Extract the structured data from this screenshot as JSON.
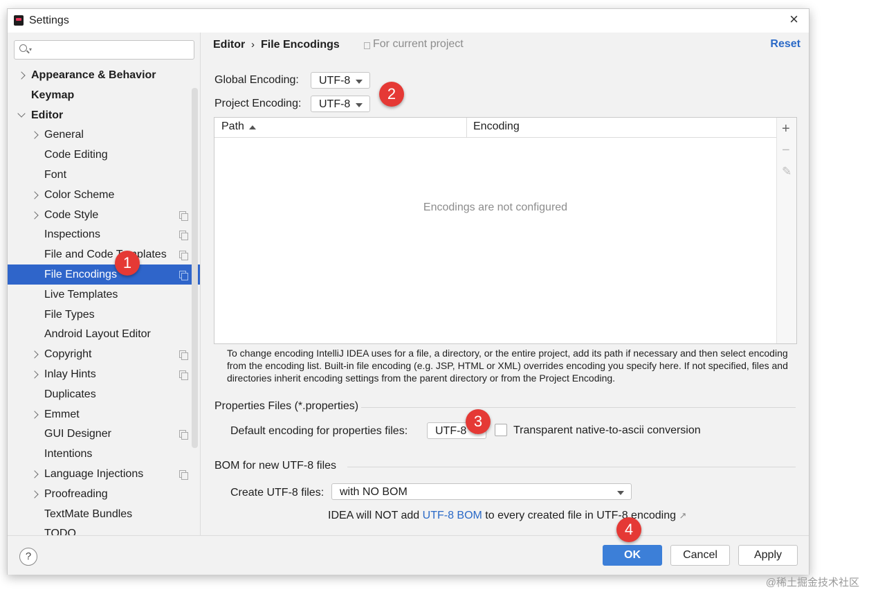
{
  "window": {
    "title": "Settings",
    "close_label": "×"
  },
  "sidebar": {
    "search_placeholder": "",
    "items": [
      {
        "label": "Appearance & Behavior",
        "level": 0,
        "arrow": "right"
      },
      {
        "label": "Keymap",
        "level": 0,
        "arrow": "none"
      },
      {
        "label": "Editor",
        "level": 0,
        "arrow": "down"
      },
      {
        "label": "General",
        "level": 1,
        "arrow": "right"
      },
      {
        "label": "Code Editing",
        "level": 1,
        "arrow": "none"
      },
      {
        "label": "Font",
        "level": 1,
        "arrow": "none"
      },
      {
        "label": "Color Scheme",
        "level": 1,
        "arrow": "right"
      },
      {
        "label": "Code Style",
        "level": 1,
        "arrow": "right",
        "project_icon": true
      },
      {
        "label": "Inspections",
        "level": 1,
        "arrow": "none",
        "project_icon": true
      },
      {
        "label": "File and Code Templates",
        "level": 1,
        "arrow": "none",
        "project_icon": true
      },
      {
        "label": "File Encodings",
        "level": 1,
        "arrow": "none",
        "project_icon": true,
        "selected": true
      },
      {
        "label": "Live Templates",
        "level": 1,
        "arrow": "none"
      },
      {
        "label": "File Types",
        "level": 1,
        "arrow": "none"
      },
      {
        "label": "Android Layout Editor",
        "level": 1,
        "arrow": "none"
      },
      {
        "label": "Copyright",
        "level": 1,
        "arrow": "right",
        "project_icon": true
      },
      {
        "label": "Inlay Hints",
        "level": 1,
        "arrow": "right",
        "project_icon": true
      },
      {
        "label": "Duplicates",
        "level": 1,
        "arrow": "none"
      },
      {
        "label": "Emmet",
        "level": 1,
        "arrow": "right"
      },
      {
        "label": "GUI Designer",
        "level": 1,
        "arrow": "none",
        "project_icon": true
      },
      {
        "label": "Intentions",
        "level": 1,
        "arrow": "none"
      },
      {
        "label": "Language Injections",
        "level": 1,
        "arrow": "right",
        "project_icon": true
      },
      {
        "label": "Proofreading",
        "level": 1,
        "arrow": "right"
      },
      {
        "label": "TextMate Bundles",
        "level": 1,
        "arrow": "none"
      },
      {
        "label": "TODO",
        "level": 1,
        "arrow": "none"
      }
    ]
  },
  "header": {
    "crumb_parent": "Editor",
    "crumb_separator": "›",
    "crumb_current": "File Encodings",
    "scope": "For current project",
    "reset": "Reset"
  },
  "encodings": {
    "global_label": "Global Encoding:",
    "global_value": "UTF-8",
    "project_label": "Project Encoding:",
    "project_value": "UTF-8"
  },
  "table": {
    "col_path": "Path",
    "col_encoding": "Encoding",
    "empty_text": "Encodings are not configured",
    "tool_add": "+",
    "tool_remove": "−",
    "tool_edit": "✎"
  },
  "help_text": "To change encoding IntelliJ IDEA uses for a file, a directory, or the entire project, add its path if necessary and then select encoding from the encoding list. Built-in file encoding (e.g. JSP, HTML or XML) overrides encoding you specify here. If not specified, files and directories inherit encoding settings from the parent directory or from the Project Encoding.",
  "properties": {
    "section_title": "Properties Files (*.properties)",
    "default_label": "Default encoding for properties files:",
    "default_value": "UTF-8",
    "transparent_label": "Transparent native-to-ascii conversion"
  },
  "bom": {
    "section_title": "BOM for new UTF-8 files",
    "create_label": "Create UTF-8 files:",
    "create_value": "with NO BOM",
    "note_prefix": "IDEA will NOT add ",
    "note_link": "UTF-8 BOM",
    "note_suffix": " to every created file in UTF-8 encoding",
    "note_ext_icon": "↗"
  },
  "buttons": {
    "help": "?",
    "ok": "OK",
    "cancel": "Cancel",
    "apply": "Apply"
  },
  "annotations": [
    "1",
    "2",
    "3",
    "4"
  ],
  "watermark": "@稀土掘金技术社区",
  "colors": {
    "accent": "#2f65ca",
    "link": "#2b6ac7",
    "badge": "#e53935",
    "ok_button": "#3c7fd8"
  }
}
